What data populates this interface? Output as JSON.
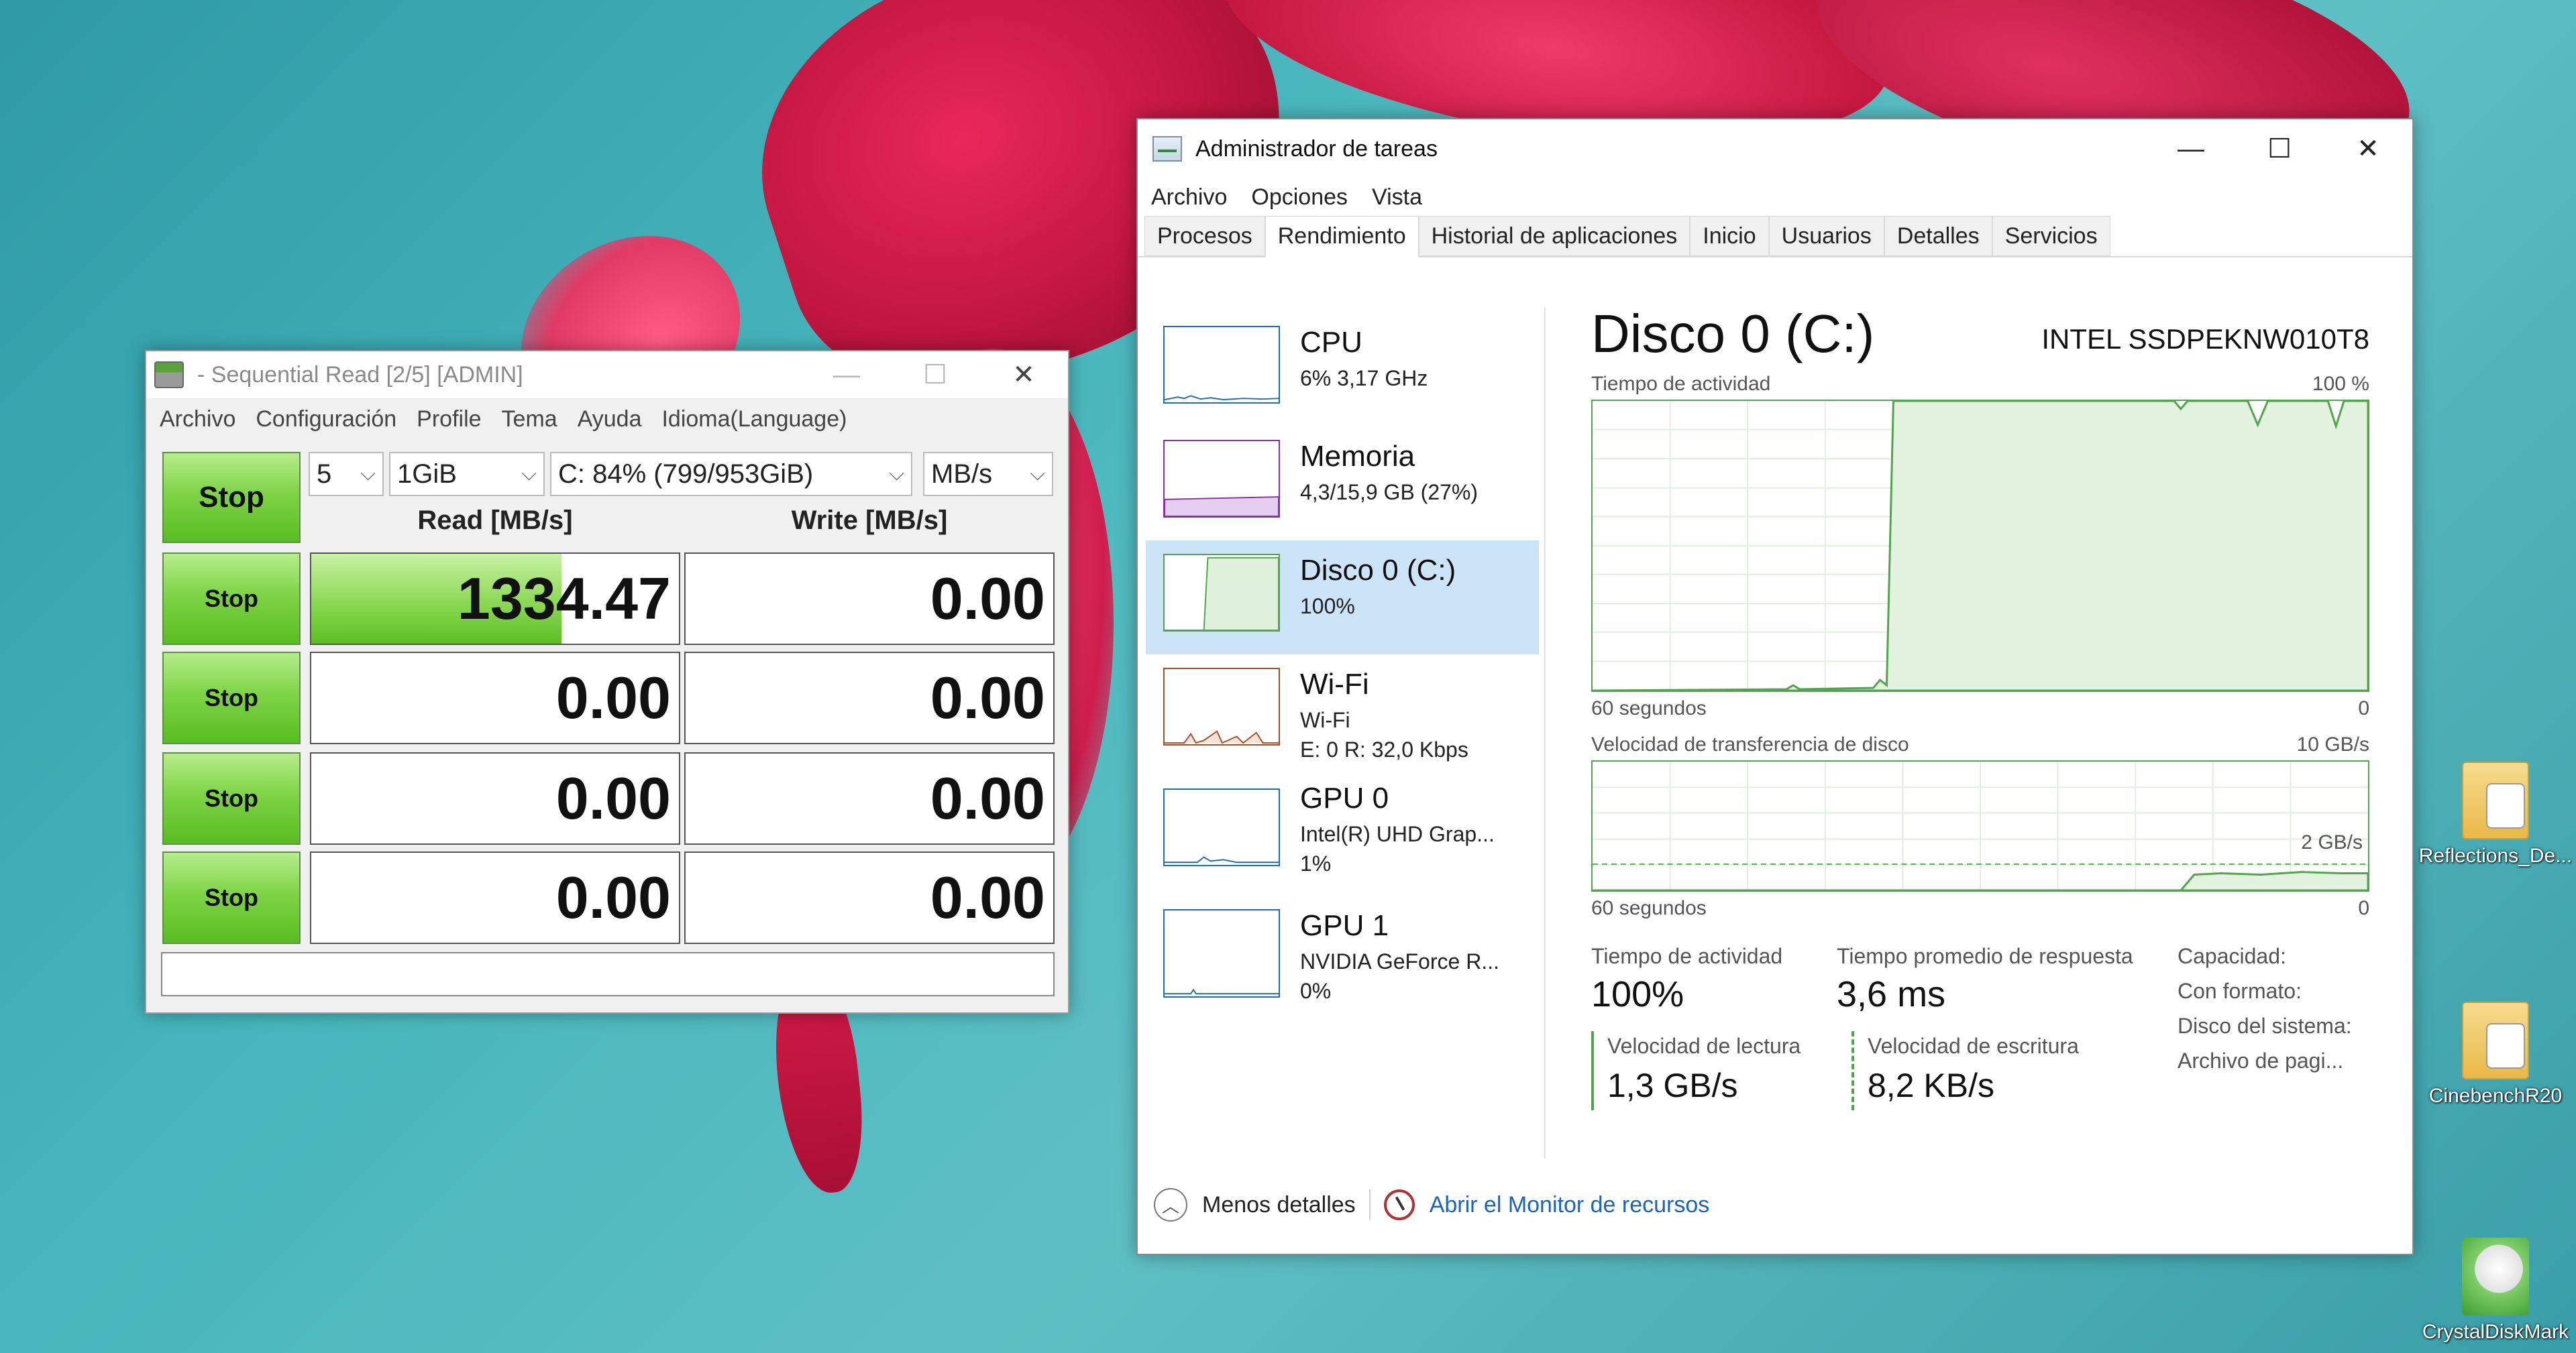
{
  "cdm": {
    "title": "- Sequential Read [2/5] [ADMIN]",
    "menu": [
      "Archivo",
      "Configuración",
      "Profile",
      "Tema",
      "Ayuda",
      "Idioma(Language)"
    ],
    "all_button": "Stop",
    "count": "5",
    "size": "1GiB",
    "drive": "C: 84% (799/953GiB)",
    "unit": "MB/s",
    "read_header": "Read [MB/s]",
    "write_header": "Write [MB/s]",
    "row_button": "Stop",
    "rows": [
      {
        "read": "1334.47",
        "write": "0.00",
        "read_fill_pct": 68
      },
      {
        "read": "0.00",
        "write": "0.00",
        "read_fill_pct": 0
      },
      {
        "read": "0.00",
        "write": "0.00",
        "read_fill_pct": 0
      },
      {
        "read": "0.00",
        "write": "0.00",
        "read_fill_pct": 0
      }
    ],
    "status": ""
  },
  "taskmanager": {
    "title": "Administrador de tareas",
    "menu": [
      "Archivo",
      "Opciones",
      "Vista"
    ],
    "tabs": [
      "Procesos",
      "Rendimiento",
      "Historial de aplicaciones",
      "Inicio",
      "Usuarios",
      "Detalles",
      "Servicios"
    ],
    "active_tab": "Rendimiento",
    "sidebar": [
      {
        "name": "CPU",
        "detail1": "6% 3,17 GHz",
        "detail2": "",
        "color": "#1f6fb0"
      },
      {
        "name": "Memoria",
        "detail1": "4,3/15,9 GB (27%)",
        "detail2": "",
        "color": "#8b2fa8"
      },
      {
        "name": "Disco 0 (C:)",
        "detail1": "100%",
        "detail2": "",
        "color": "#4fa64c"
      },
      {
        "name": "Wi-Fi",
        "detail1": "Wi-Fi",
        "detail2": "E: 0 R: 32,0 Kbps",
        "color": "#a0522d"
      },
      {
        "name": "GPU 0",
        "detail1": "Intel(R) UHD Grap...",
        "detail2": "1%",
        "color": "#1f6fb0"
      },
      {
        "name": "GPU 1",
        "detail1": "NVIDIA GeForce R...",
        "detail2": "0%",
        "color": "#1f6fb0"
      }
    ],
    "selected": "Disco 0 (C:)",
    "main": {
      "title": "Disco 0 (C:)",
      "model": "INTEL SSDPEKNW010T8",
      "graph1_label": "Tiempo de actividad",
      "graph1_max": "100 %",
      "graph1_time": "60 segundos",
      "graph1_min": "0",
      "graph2_label": "Velocidad de transferencia de disco",
      "graph2_max": "10 GB/s",
      "graph2_mid": "2 GB/s",
      "graph2_time": "60 segundos",
      "graph2_min": "0",
      "active_label": "Tiempo de actividad",
      "active_value": "100%",
      "resp_label": "Tiempo promedio de respuesta",
      "resp_value": "3,6 ms",
      "read_label": "Velocidad de lectura",
      "read_value": "1,3 GB/s",
      "write_label": "Velocidad de escritura",
      "write_value": "8,2 KB/s",
      "props": [
        "Capacidad:",
        "Con formato:",
        "Disco del sistema:",
        "Archivo de pagi..."
      ]
    },
    "footer": {
      "less": "Menos detalles",
      "monitor": "Abrir el Monitor de recursos"
    }
  },
  "desktop": {
    "icons": [
      "Reflections_De...",
      "CinebenchR20",
      "CrystalDiskMark"
    ]
  }
}
